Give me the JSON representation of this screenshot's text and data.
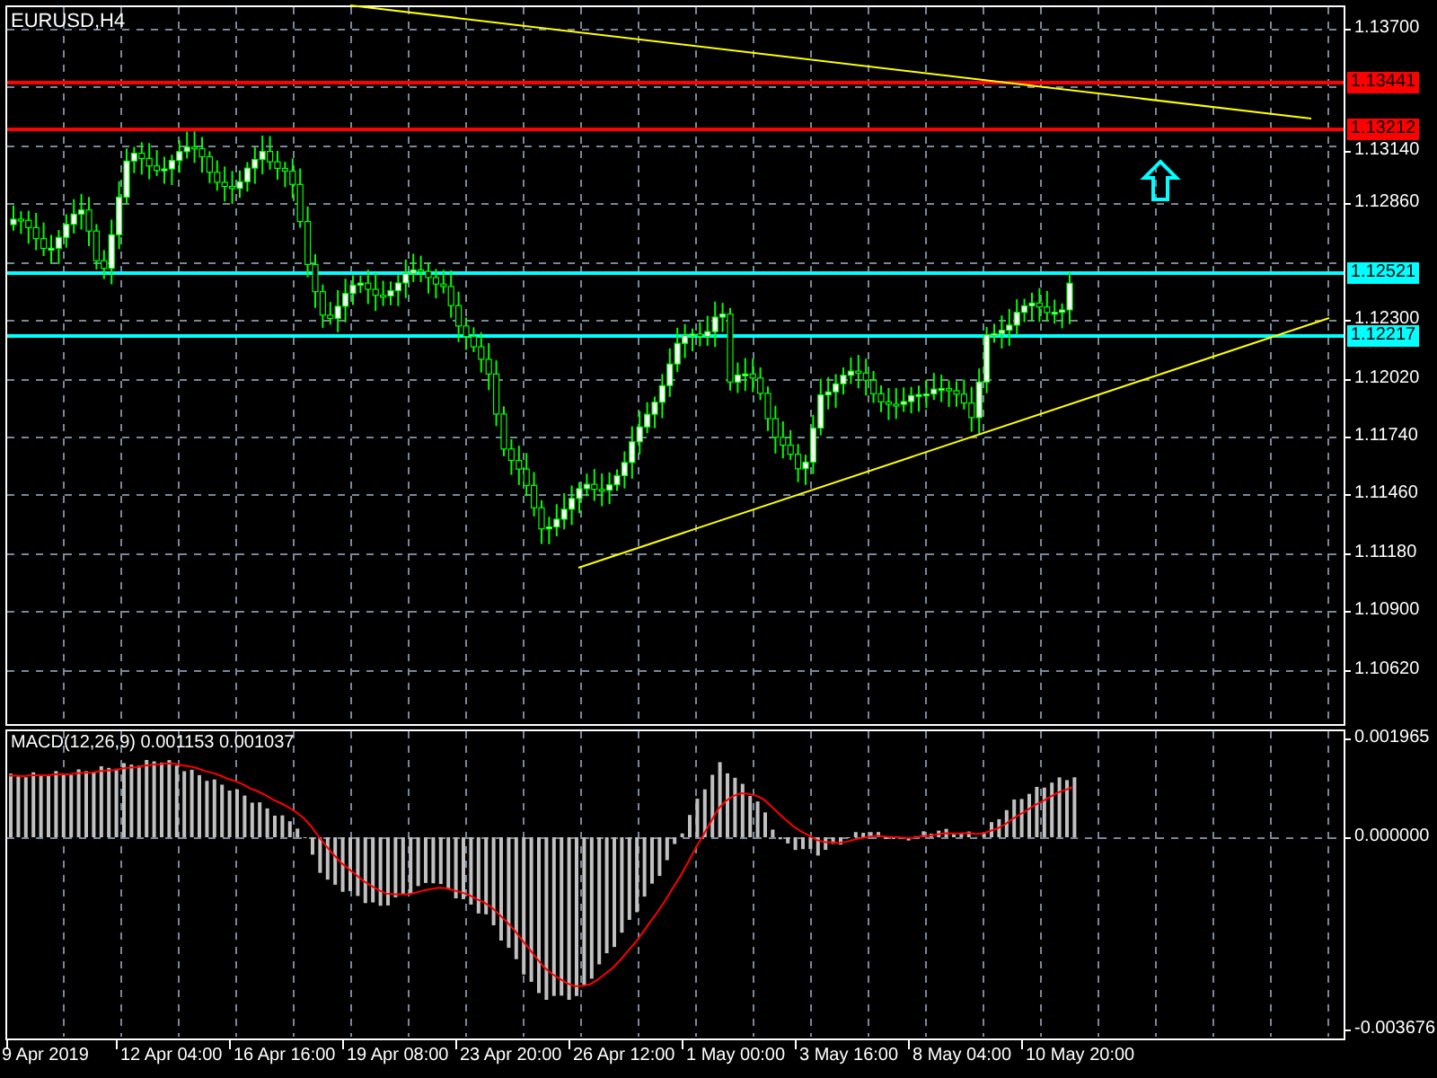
{
  "chart": {
    "title": "EURUSD,H4"
  },
  "price_axis": [
    "1.13700",
    "1.13140",
    "1.12860",
    "1.12300",
    "1.12020",
    "1.11740",
    "1.11460",
    "1.11180",
    "1.10900",
    "1.10620"
  ],
  "level_lines": [
    {
      "label": "1.13441",
      "color": "#ff0000"
    },
    {
      "label": "1.13212",
      "color": "#ff0000"
    },
    {
      "label": "1.12521",
      "color": "#00ffff"
    },
    {
      "label": "1.12217",
      "color": "#00ffff"
    }
  ],
  "indicator": {
    "label": "MACD(12,26,9) 0.001153 0.001037",
    "axis": [
      "0.001965",
      "0.000000",
      "-0.003676"
    ]
  },
  "time_axis": [
    "9 Apr 2019",
    "12 Apr 04:00",
    "16 Apr 16:00",
    "19 Apr 08:00",
    "23 Apr 20:00",
    "26 Apr 12:00",
    "1 May 00:00",
    "3 May 16:00",
    "8 May 04:00",
    "10 May 20:00"
  ]
}
